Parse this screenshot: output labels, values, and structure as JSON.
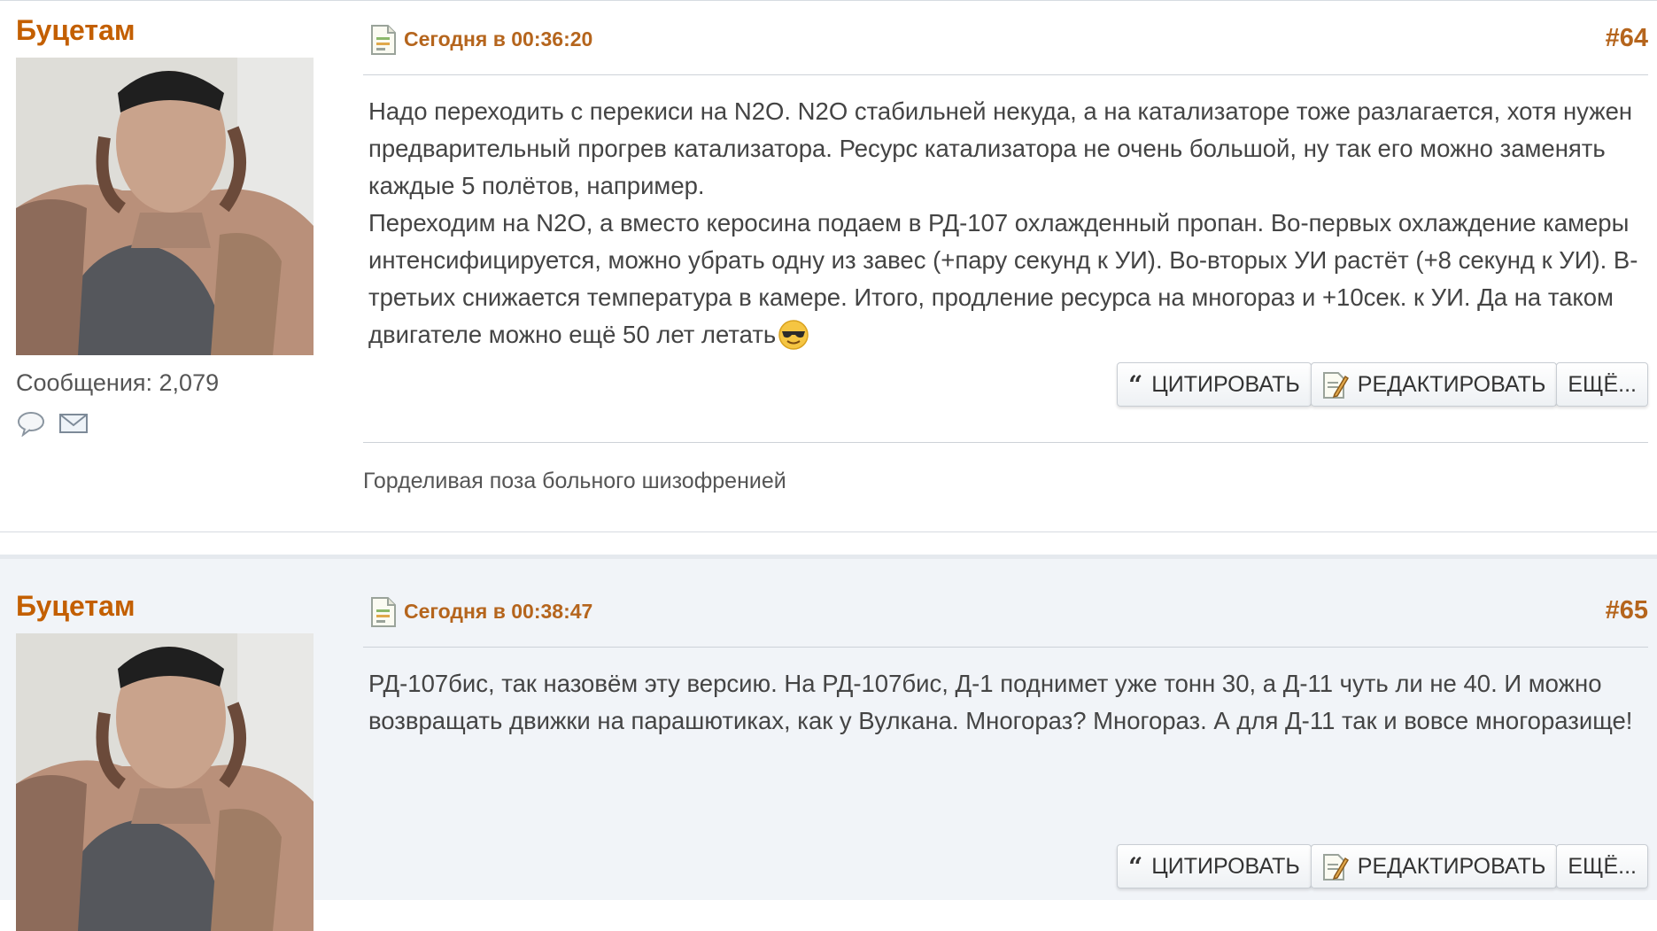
{
  "posts": [
    {
      "author": "Буцетам",
      "messages_label": "Сообщения: 2,079",
      "date": "Сегодня в 00:36:20",
      "number": "#64",
      "body": [
        "Надо переходить с перекиси на N2O. N2O стабильней некуда, а на катализаторе тоже разлагается, хотя нужен предварительный прогрев катализатора. Ресурс катализатора не очень большой, ну так его можно заменять каждые 5 полётов, например.",
        "Переходим на N2O, а вместо керосина подаем в РД-107 охлажденный пропан. Во-первых охлаждение камеры интенсифицируется, можно убрать одну из завес (+пару секунд к УИ). Во-вторых УИ растёт (+8 секунд к УИ). В-третьих снижается температура в камере. Итого, продление ресурса на многораз и +10сек. к УИ. Да на таком двигателе можно ещё 50 лет летать"
      ],
      "signature": "Горделивая поза больного шизофренией"
    },
    {
      "author": "Буцетам",
      "date": "Сегодня в 00:38:47",
      "number": "#65",
      "body": [
        "РД-107бис, так назовём эту версию. На РД-107бис, Д-1 поднимет уже тонн 30, а Д-11 чуть ли не 40. И можно возвращать движки на парашютиках, как у Вулкана. Многораз? Многораз. А для Д-11 так и вовсе многоразище!"
      ]
    }
  ],
  "actions": {
    "quote": "ЦИТИРОВАТЬ",
    "edit": "РЕДАКТИРОВАТЬ",
    "more": "ЕЩЁ..."
  },
  "icons": {
    "quote": "quote-icon",
    "edit": "edit-icon",
    "post_date": "document-icon",
    "emoji": "sunglasses-emoji-icon",
    "pm": "chat-bubble-icon",
    "email": "envelope-icon"
  },
  "colors": {
    "accent": "#c35f00",
    "date": "#b5651d",
    "alt_background": "#f1f4f8"
  }
}
